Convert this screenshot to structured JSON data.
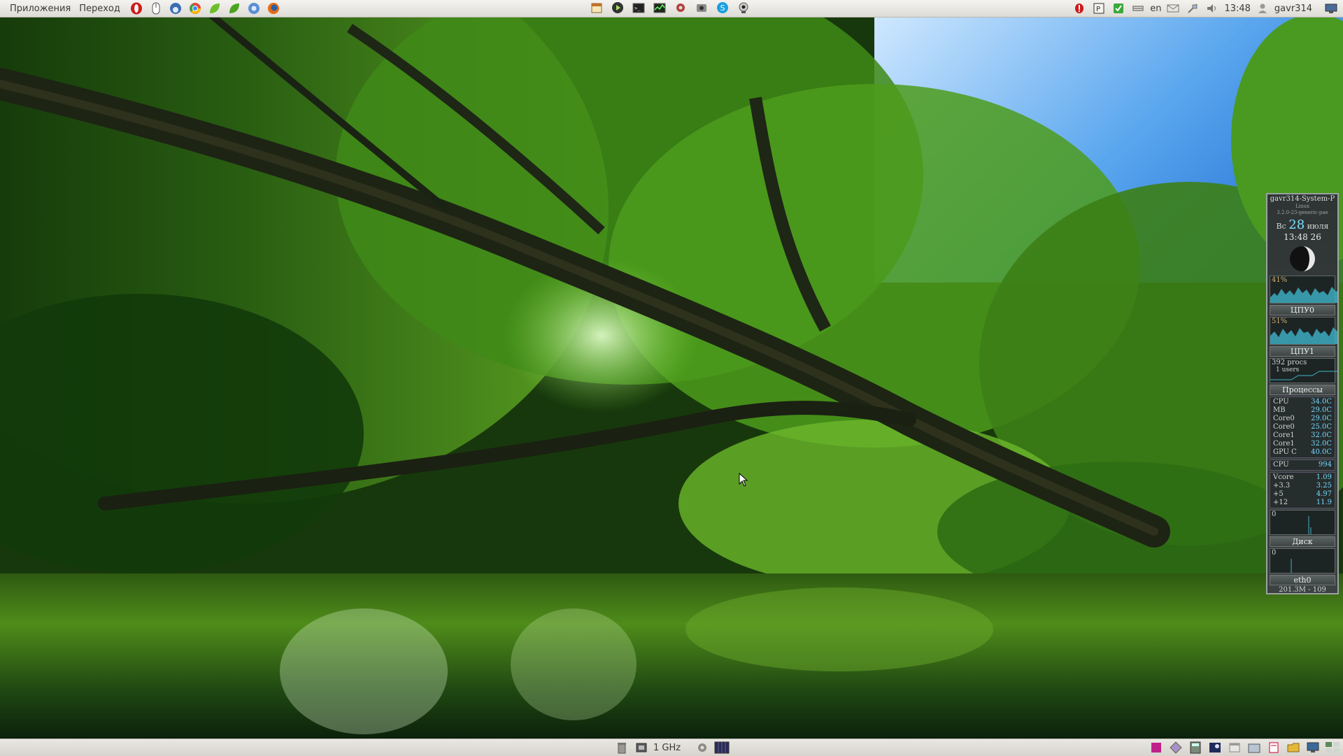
{
  "top_panel": {
    "menus": [
      "Приложения",
      "Переход"
    ],
    "launchers": [
      "opera-icon",
      "mouse-icon",
      "thunderbird-icon",
      "chrome-icon",
      "leaf-icon",
      "leaf2-icon",
      "chromium-icon",
      "firefox-icon"
    ],
    "center_apps": [
      "calendar-icon",
      "media-player-icon",
      "terminal-icon",
      "system-monitor-icon",
      "settings-icon",
      "screenshot-icon",
      "skype-icon",
      "webcam-icon"
    ],
    "tray": {
      "keyboard_layout": "en",
      "clock": "13:48",
      "user": "gavr314"
    }
  },
  "bottom_panel": {
    "cpu_freq": "1 GHz"
  },
  "widget": {
    "hostname": "gavr314-System-P",
    "subline1": "Linux",
    "subline2": "3.2.0-23-generic-pae",
    "weekday": "Вс",
    "day": "28",
    "month": "июля",
    "time": "13:48 26",
    "cpu0_pct": "41%",
    "cpu0_label": "ЦПУ0",
    "cpu1_pct": "51%",
    "cpu1_label": "ЦПУ1",
    "procs": "392 procs",
    "users": "1 users",
    "procs_label": "Процессы",
    "sensors": [
      {
        "name": "CPU",
        "value": "34.0C"
      },
      {
        "name": "MB",
        "value": "29.0C"
      },
      {
        "name": "Core0",
        "value": "29.0C"
      },
      {
        "name": "Core0",
        "value": "25.0C"
      },
      {
        "name": "Core1",
        "value": "32.0C"
      },
      {
        "name": "Core1",
        "value": "32.0C"
      },
      {
        "name": "GPU C",
        "value": "40.0C"
      }
    ],
    "fan": {
      "name": "CPU",
      "value": "994"
    },
    "voltages": [
      {
        "name": "Vcore",
        "value": "1.09"
      },
      {
        "name": "+3.3",
        "value": "3.25"
      },
      {
        "name": "+5",
        "value": "4.97"
      },
      {
        "name": "+12",
        "value": "11.9"
      }
    ],
    "disk_value": "0",
    "disk_label": "Диск",
    "net_value": "0",
    "net_label": "eth0",
    "net_total": "201.3M - 109"
  },
  "colors": {
    "panel_bg": "#dedcd6",
    "widget_bg": "#2f3434",
    "widget_accent": "#74d8ff"
  }
}
